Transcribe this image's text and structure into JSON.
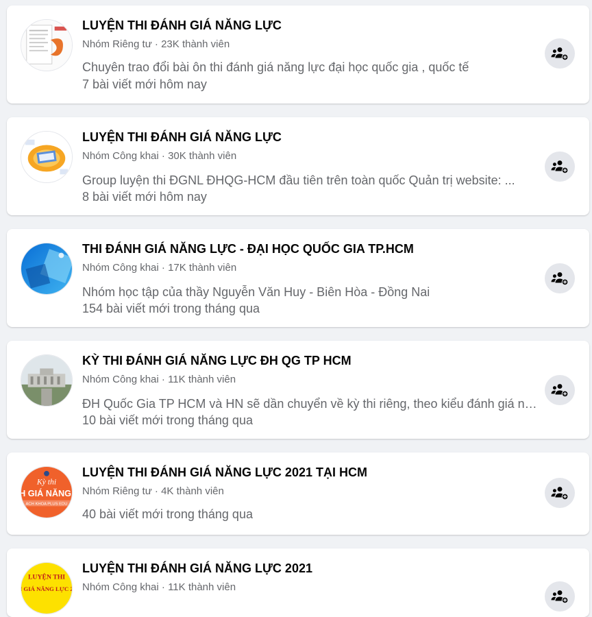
{
  "groups": [
    {
      "title": "LUYỆN THI ĐÁNH GIÁ NĂNG LỰC",
      "privacy": "Nhóm Riêng tư",
      "members": "23K thành viên",
      "description": "Chuyên trao đổi bài ôn thi đánh giá năng lực đại học quốc gia , quốc tế",
      "activity": "7 bài viết mới hôm nay",
      "avatar_icon": "document-avatar"
    },
    {
      "title": "LUYỆN THI ĐÁNH GIÁ NĂNG LỰC",
      "privacy": "Nhóm Công khai",
      "members": "30K thành viên",
      "description": "Group luyện thi ĐGNL ĐHQG-HCM đầu tiên trên toàn quốc Quản trị website: ...",
      "activity": "8 bài viết mới hôm nay",
      "avatar_icon": "book-avatar"
    },
    {
      "title": "THI ĐÁNH GIÁ NĂNG LỰC - ĐẠI HỌC QUỐC GIA TP.HCM",
      "privacy": "Nhóm Công khai",
      "members": "17K thành viên",
      "description": "Nhóm học tập của thầy Nguyễn Văn Huy - Biên Hòa - Đồng Nai",
      "activity": "154 bài viết mới trong tháng qua",
      "avatar_icon": "blue-abstract-avatar"
    },
    {
      "title": "KỲ THI ĐÁNH GIÁ NĂNG LỰC ĐH QG TP HCM",
      "privacy": "Nhóm Công khai",
      "members": "11K thành viên",
      "description": "ĐH Quốc Gia TP HCM và HN sẽ dần chuyển về kỳ thi riêng, theo kiểu đánh giá năng lực",
      "activity": "10 bài viết mới trong tháng qua",
      "avatar_icon": "campus-avatar"
    },
    {
      "title": "LUYỆN THI ĐÁNH GIÁ NĂNG LỰC 2021 TẠI HCM",
      "privacy": "Nhóm Riêng tư",
      "members": "4K thành viên",
      "description": "",
      "activity": "40 bài viết mới trong tháng qua",
      "avatar_icon": "orange-logo-avatar",
      "avatar_text": [
        "Kỳ thi",
        "H GIÁ NĂNG",
        "ACH KHOA PLUS EDU"
      ]
    },
    {
      "title": "LUYỆN THI ĐÁNH GIÁ NĂNG LỰC 2021",
      "privacy": "Nhóm Công khai",
      "members": "11K thành viên",
      "description": "",
      "activity": "",
      "avatar_icon": "yellow-logo-avatar",
      "avatar_text": [
        "LUYỆN THI",
        "H GIÁ NĂNG LỰC 2"
      ]
    }
  ],
  "separator": " · ",
  "join_icon": "group-join-icon",
  "colors": {
    "background": "#f0f2f5",
    "card": "#ffffff",
    "title": "#050505",
    "secondary": "#65676b",
    "button": "#e4e6eb"
  }
}
